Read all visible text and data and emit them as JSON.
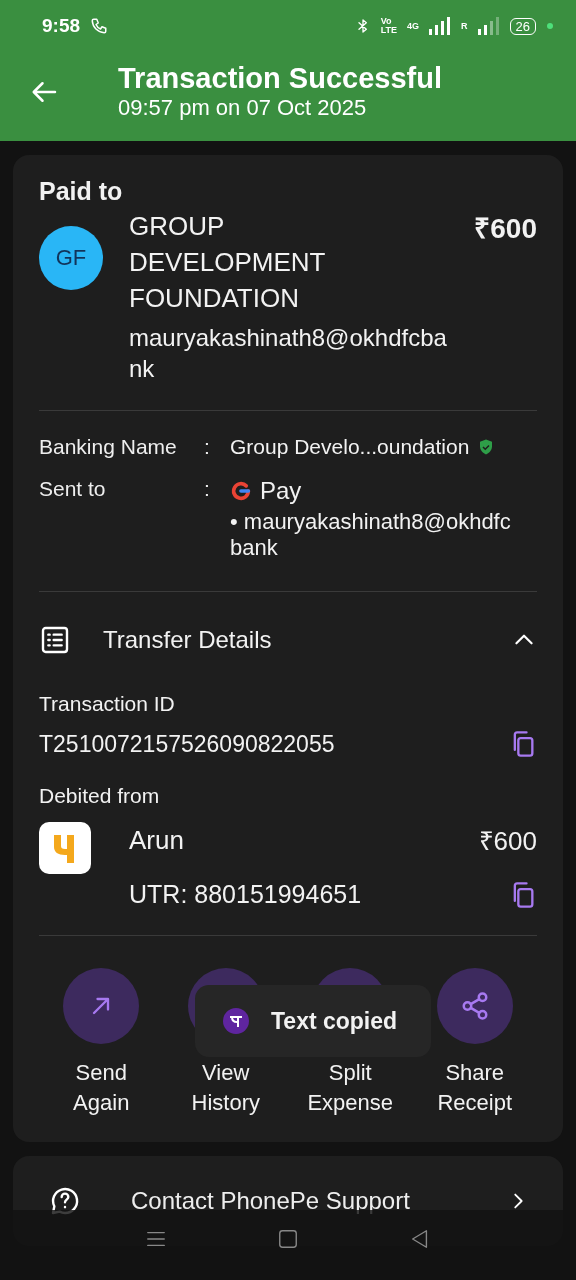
{
  "status_bar": {
    "time": "9:58",
    "volte_top": "Vo",
    "volte_bottom": "LTE",
    "network": "4G",
    "roaming": "R",
    "battery": "26"
  },
  "header": {
    "title": "Transaction Successful",
    "subtitle": "09:57 pm on 07 Oct 2025"
  },
  "paid_to": {
    "label": "Paid to",
    "avatar": "GF",
    "name": "GROUP DEVELOPMENT FOUNDATION",
    "amount": "₹600",
    "upi_id": "mauryakashinath8@okhdfcbank"
  },
  "details": [
    {
      "label": "Banking Name",
      "separator": ":",
      "value": "Group Develo...oundation",
      "verified": true
    },
    {
      "label": "Sent to",
      "separator": ":",
      "app": "Pay",
      "value": "• mauryakashinath8@okhdfcbank"
    }
  ],
  "transfer": {
    "title": "Transfer Details",
    "expanded": true,
    "id_label": "Transaction ID",
    "id": "T2510072157526090822055",
    "debited_label": "Debited from",
    "account": "Arun",
    "amount": "₹600",
    "utr": "UTR: 880151994651"
  },
  "actions": [
    {
      "label": "Send Again",
      "kind": "send"
    },
    {
      "label": "View History",
      "kind": "history"
    },
    {
      "label": "Split Expense",
      "kind": "split"
    },
    {
      "label": "Share Receipt",
      "kind": "share"
    }
  ],
  "toast": {
    "text": "Text copied"
  },
  "support": {
    "label": "Contact PhonePe Support"
  }
}
